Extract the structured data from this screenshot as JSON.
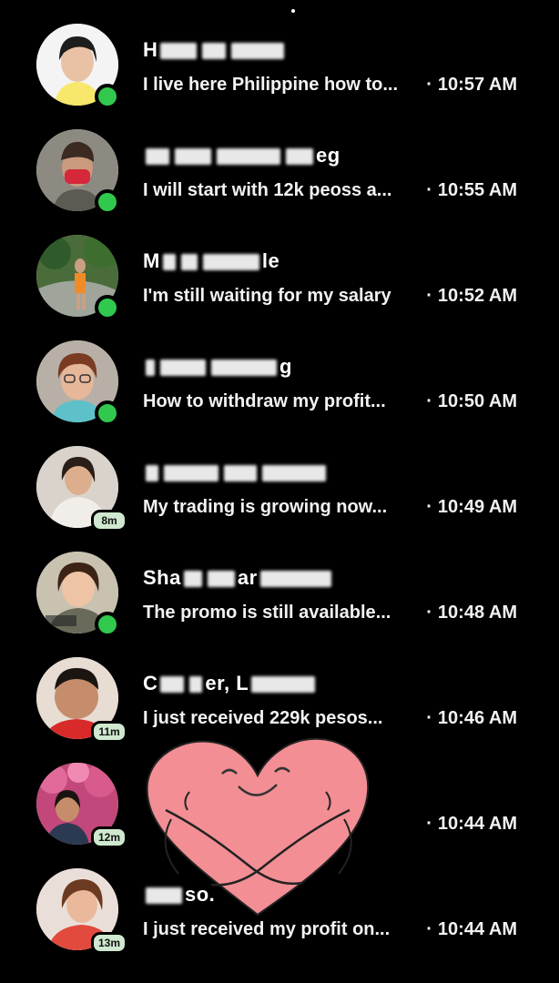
{
  "colors": {
    "background": "#000000",
    "presence": "#31c84e",
    "heart": "#f28e94",
    "heart_outline": "#222222"
  },
  "conversations": [
    {
      "name": "H",
      "name_suffix": "",
      "preview": "I live here Philippine how to...",
      "time": "10:57 AM",
      "status": "online",
      "active_ago": ""
    },
    {
      "name": "",
      "name_suffix": "eg",
      "preview": "I will start with 12k peoss a...",
      "time": "10:55 AM",
      "status": "online",
      "active_ago": ""
    },
    {
      "name": "M",
      "name_suffix": "le",
      "preview": "I'm still waiting for my salary",
      "time": "10:52 AM",
      "status": "online",
      "active_ago": ""
    },
    {
      "name": "",
      "name_suffix": "g",
      "preview": "How to withdraw my profit...",
      "time": "10:50 AM",
      "status": "online",
      "active_ago": ""
    },
    {
      "name": "",
      "name_suffix": "",
      "preview": "My trading is growing now...",
      "time": "10:49 AM",
      "status": "away",
      "active_ago": "8m"
    },
    {
      "name": "Sha",
      "name_suffix": "ar",
      "preview": "The promo is still available...",
      "time": "10:48 AM",
      "status": "online",
      "active_ago": ""
    },
    {
      "name": "C",
      "name_suffix": "er, L",
      "preview": "I just received 229k pesos...",
      "time": "10:46 AM",
      "status": "away",
      "active_ago": "11m"
    },
    {
      "name": "",
      "name_suffix": "",
      "preview": "",
      "time": "10:44 AM",
      "status": "away",
      "active_ago": "12m"
    },
    {
      "name": "",
      "name_suffix": "so.",
      "preview": "I just received my profit on...",
      "time": "10:44 AM",
      "status": "away",
      "active_ago": "13m"
    }
  ],
  "time_separator": "·"
}
